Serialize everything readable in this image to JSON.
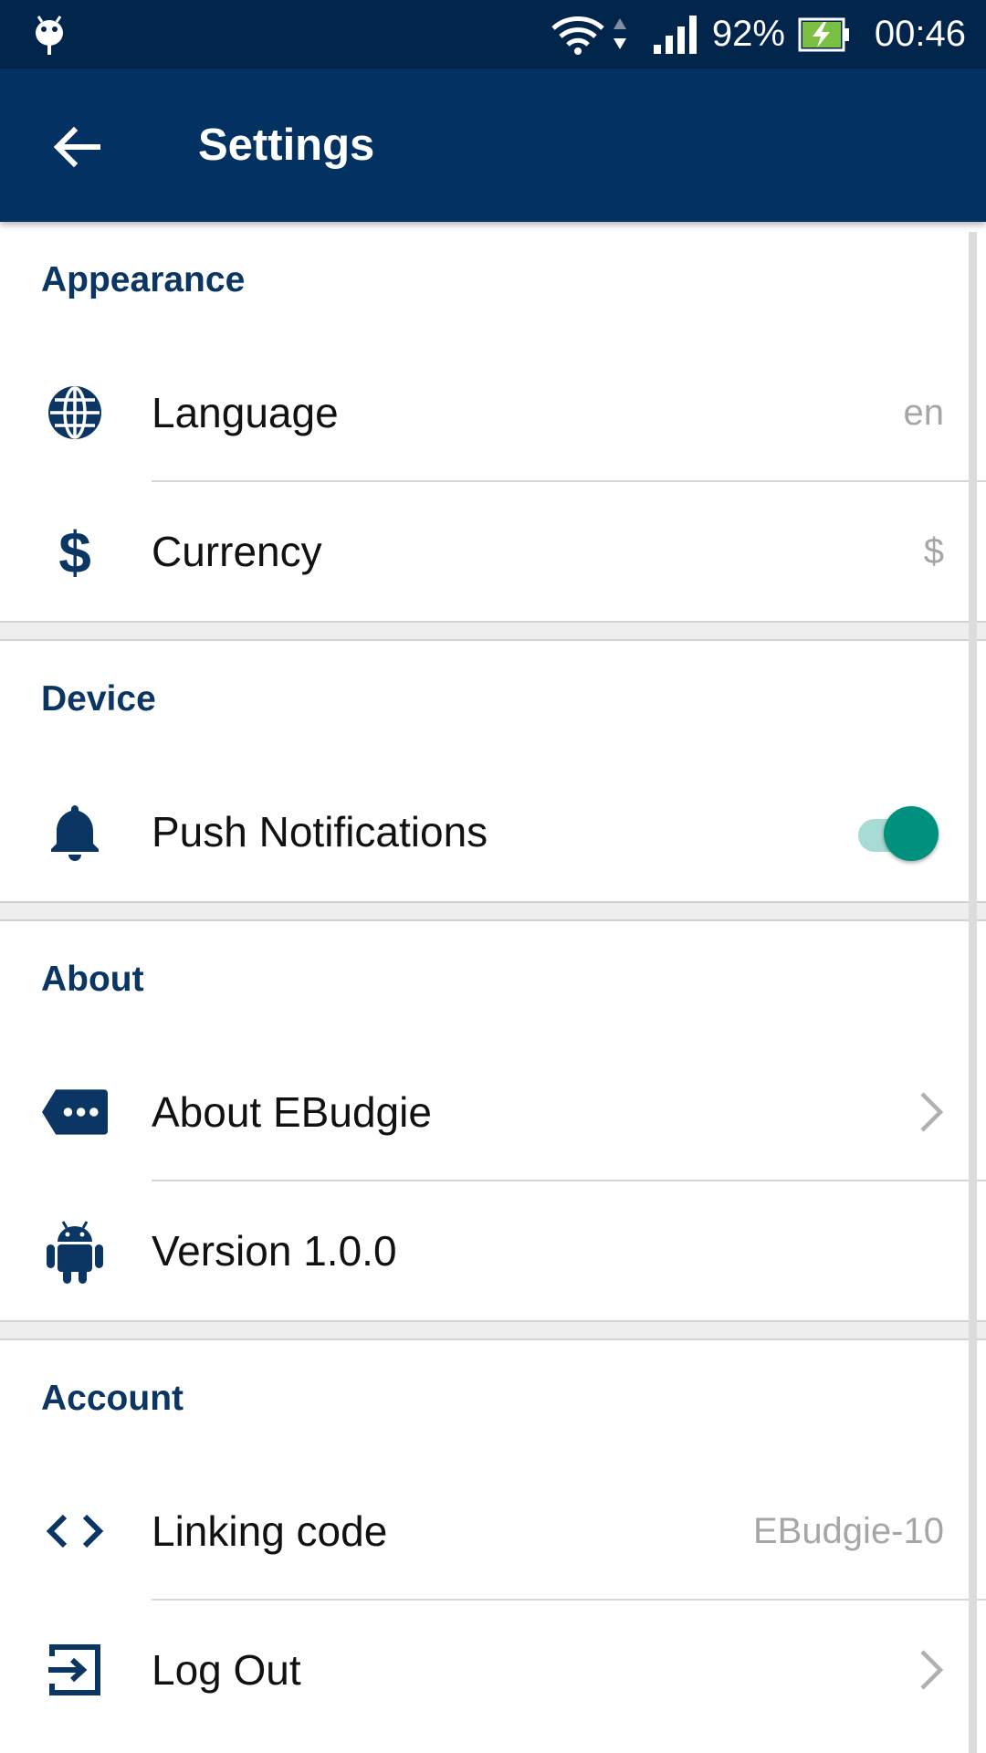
{
  "status_bar": {
    "battery_percent": "92%",
    "time": "00:46",
    "icons": [
      "notification-icon",
      "wifi-icon",
      "data-arrows-icon",
      "signal-icon",
      "battery-charging-icon"
    ]
  },
  "app_bar": {
    "back_icon": "arrow-left-icon",
    "title": "Settings"
  },
  "sections": {
    "appearance": {
      "header": "Appearance",
      "language": {
        "icon": "globe-icon",
        "label": "Language",
        "value": "en"
      },
      "currency": {
        "icon": "dollar-icon",
        "label": "Currency",
        "value": "$"
      }
    },
    "device": {
      "header": "Device",
      "push": {
        "icon": "bell-icon",
        "label": "Push Notifications",
        "enabled": true
      }
    },
    "about": {
      "header": "About",
      "about_app": {
        "icon": "ellipsis-tag-icon",
        "label": "About EBudgie"
      },
      "version": {
        "icon": "android-icon",
        "label": "Version 1.0.0"
      }
    },
    "account": {
      "header": "Account",
      "linking": {
        "icon": "code-icon",
        "label": "Linking code",
        "value": "EBudgie-10"
      },
      "logout": {
        "icon": "logout-icon",
        "label": "Log Out"
      }
    }
  },
  "colors": {
    "status_bar": "#02264b",
    "app_bar": "#033262",
    "section_header": "#0b3663",
    "icon": "#0b3663",
    "toggle_on": "#00907e",
    "toggle_track": "#a8dbd5",
    "secondary_text": "#a6a6a6"
  }
}
